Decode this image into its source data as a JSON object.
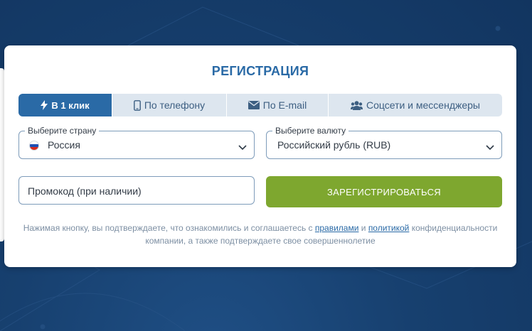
{
  "page": {
    "title": "РЕГИСТРАЦИЯ"
  },
  "tabs": [
    {
      "label": "В 1 клик",
      "icon": "lightning-icon",
      "active": true
    },
    {
      "label": "По телефону",
      "icon": "phone-icon",
      "active": false
    },
    {
      "label": "По E-mail",
      "icon": "envelope-icon",
      "active": false
    },
    {
      "label": "Соцсети и мессенджеры",
      "icon": "users-icon",
      "active": false
    }
  ],
  "country": {
    "legend": "Выберите страну",
    "value": "Россия",
    "flag_icon": "russia-flag-icon"
  },
  "currency": {
    "legend": "Выберите валюту",
    "value": "Российский рубль (RUB)"
  },
  "promo": {
    "placeholder": "Промокод (при наличии)"
  },
  "register": {
    "label": "ЗАРЕГИСТРИРОВАТЬСЯ"
  },
  "disclaimer": {
    "text_before": "Нажимая кнопку, вы подтверждаете, что ознакомились и соглашаетесь с ",
    "rules_link": "правилами",
    "and": " и ",
    "policy_link": "политикой",
    "text_after": " конфиденциальности компании, а также подтверждаете свое совершеннолетие"
  },
  "colors": {
    "primary": "#2a6aa6",
    "accent_green": "#7ea72f",
    "background": "#17406f",
    "tab_bg": "#dde6ef"
  }
}
